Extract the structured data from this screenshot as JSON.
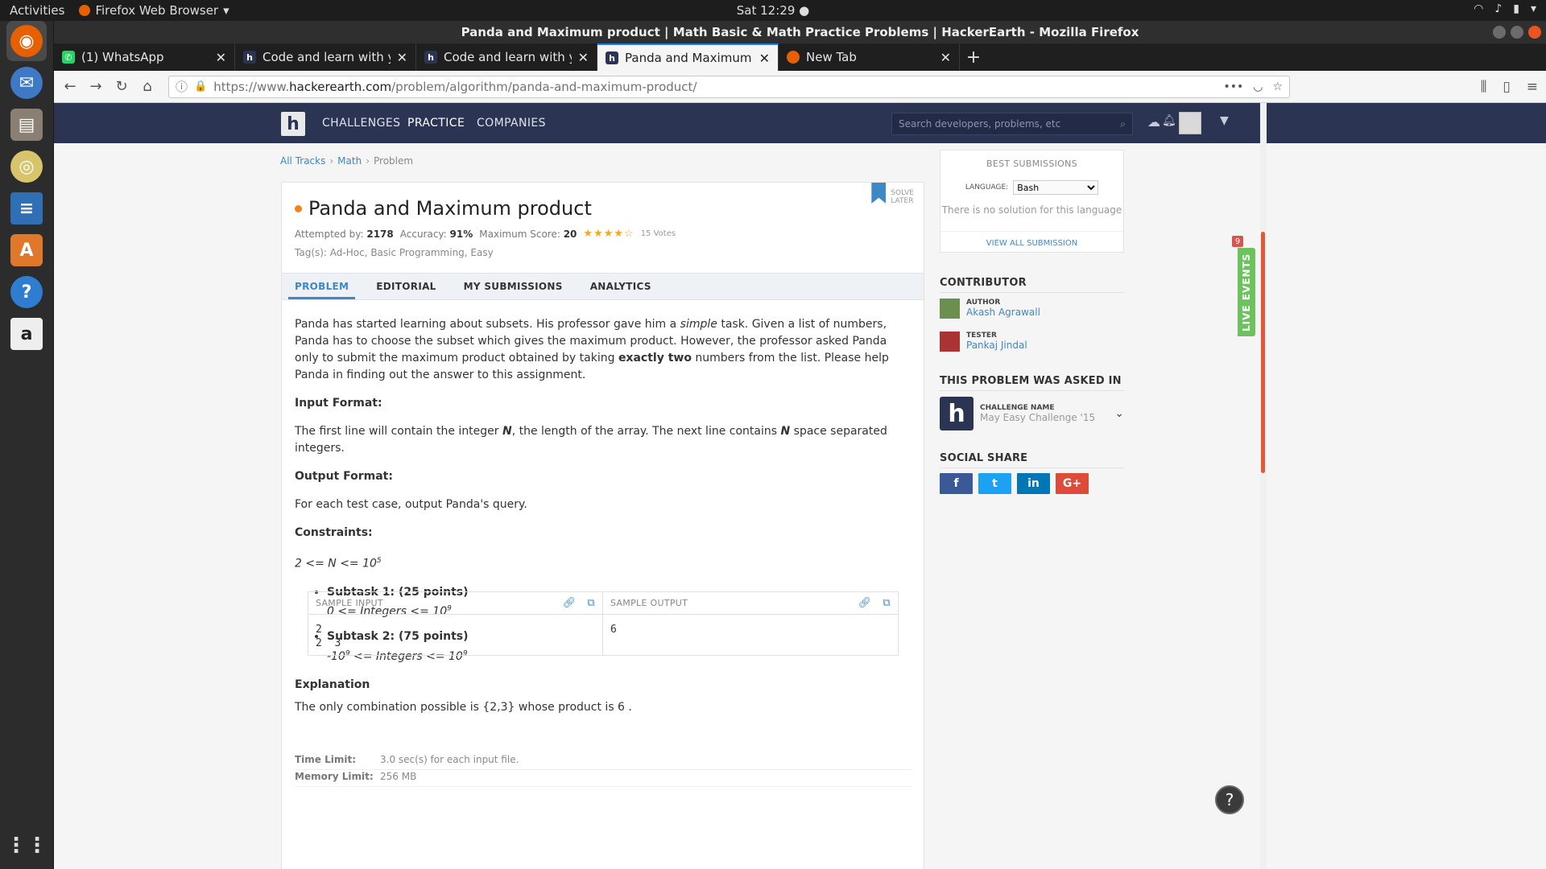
{
  "os": {
    "activities": "Activities",
    "app_name": "Firefox Web Browser",
    "clock": "Sat 12:29 ●"
  },
  "window": {
    "title": "Panda and Maximum product | Math Basic & Math Practice Problems | HackerEarth - Mozilla Firefox"
  },
  "tabs": [
    {
      "label": "(1) WhatsApp"
    },
    {
      "label": "Code and learn with your"
    },
    {
      "label": "Code and learn with your"
    },
    {
      "label": "Panda and Maximum pro"
    },
    {
      "label": "New Tab"
    }
  ],
  "url": {
    "prefix": "https://www.",
    "domain": "hackerearth.com",
    "path": "/problem/algorithm/panda-and-maximum-product/"
  },
  "site": {
    "logo": "h",
    "menu": [
      "CHALLENGES",
      "PRACTICE",
      "COMPANIES"
    ],
    "search_placeholder": "Search developers, problems, etc"
  },
  "breadcrumb": {
    "items": [
      "All Tracks",
      "Math",
      "Problem"
    ]
  },
  "problem": {
    "title": "Panda and Maximum product",
    "attempted_label": "Attempted by:",
    "attempted": "2178",
    "accuracy_label": "Accuracy:",
    "accuracy": "91%",
    "max_score_label": "Maximum Score:",
    "max_score": "20",
    "rating_stars": 4,
    "votes": "15 Votes",
    "tags": "Tag(s): Ad-Hoc, Basic Programming, Easy",
    "solve_later_1": "SOLVE",
    "solve_later_2": "LATER",
    "tabs": [
      "PROBLEM",
      "EDITORIAL",
      "MY SUBMISSIONS",
      "ANALYTICS"
    ],
    "statement_a": "Panda has started learning about subsets. His professor gave him a ",
    "statement_em": "simple",
    "statement_b": " task. Given a list of numbers, Panda has to choose the subset which gives the maximum product. However, the professor asked Panda only to submit the maximum product obtained by taking ",
    "statement_bold": "exactly two",
    "statement_c": " numbers from the list. Please help Panda in finding out the answer to this assignment.",
    "input_format_h": "Input Format:",
    "input_format_a": "The first line will contain the integer ",
    "input_format_n1": "N",
    "input_format_b": ", the length of the array. The next line contains ",
    "input_format_n2": "N",
    "input_format_c": " space separated integers.",
    "output_format_h": "Output Format:",
    "output_format": "For each test case, output Panda's query.",
    "constraints_h": "Constraints:",
    "constraint_main": "2 <= N <= 10",
    "constraint_main_exp": "5",
    "subtask1_title": "Subtask 1: (25 points)",
    "subtask1_a": "0 <= Integers <= 10",
    "subtask1_exp": "9",
    "subtask2_title": "Subtask 2: (75 points)",
    "subtask2_pre": "-10",
    "subtask2_pre_exp": "9",
    "subtask2_a": " <= Integers <= 10",
    "subtask2_exp": "9",
    "sample_input_label": "SAMPLE INPUT",
    "sample_input": "2\n2  3",
    "sample_output_label": "SAMPLE OUTPUT",
    "sample_output": "6",
    "explanation_h": "Explanation",
    "explanation": "The only combination possible is {2,3} whose product is 6 .",
    "time_limit_label": "Time Limit:",
    "time_limit": "3.0 sec(s) for each input file.",
    "memory_limit_label": "Memory Limit:",
    "memory_limit": "256 MB"
  },
  "sidebar": {
    "best_title": "BEST SUBMISSIONS",
    "language_label": "LANGUAGE:",
    "language_value": "Bash",
    "no_solution": "There is no solution for this language",
    "view_all": "VIEW ALL SUBMISSION",
    "contributor_h": "CONTRIBUTOR",
    "author_role": "AUTHOR",
    "author_name": "Akash Agrawall",
    "tester_role": "TESTER",
    "tester_name": "Pankaj Jindal",
    "asked_h": "THIS PROBLEM WAS ASKED IN",
    "challenge_label": "CHALLENGE NAME",
    "challenge_name": "May Easy Challenge '15",
    "social_h": "SOCIAL SHARE",
    "social": [
      {
        "label": "f",
        "color": "#3b5998"
      },
      {
        "label": "t",
        "color": "#1da1f2"
      },
      {
        "label": "in",
        "color": "#0077b5"
      },
      {
        "label": "G+",
        "color": "#dd4b39"
      }
    ]
  },
  "live_events": {
    "label": "LIVE EVENTS",
    "count": "9"
  },
  "colors": {
    "accent": "#3e88c6",
    "nav": "#2c3454",
    "orange": "#f48219"
  }
}
